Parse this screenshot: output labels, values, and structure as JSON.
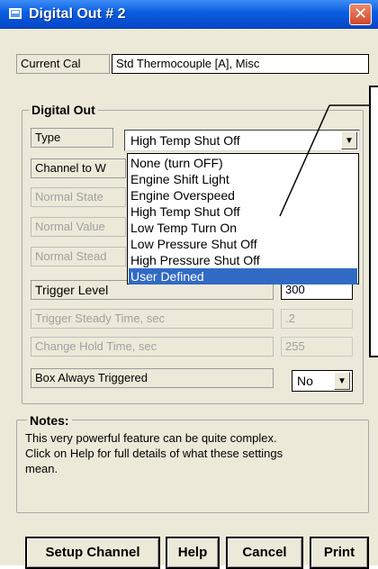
{
  "window": {
    "title": "Digital Out # 2",
    "close_glyph": "✕"
  },
  "current_cal": {
    "label": "Current Cal",
    "value": "Std Thermocouple [A], Misc"
  },
  "digital_out": {
    "legend": "Digital Out",
    "type_label": "Type",
    "type_value": "High Temp Shut Off",
    "channel_label_partial": "Channel to W",
    "normal_state_label_partial": "Normal State",
    "normal_value_label_partial": "Normal Value",
    "normal_steady_label_partial": "Normal Stead",
    "trigger_level_label": "Trigger Level",
    "trigger_level_value": "300",
    "trigger_steady_label": "Trigger Steady Time, sec",
    "trigger_steady_value": ".2",
    "change_hold_label": "Change Hold Time, sec",
    "change_hold_value": "255",
    "box_always_label": "Box Always Triggered",
    "box_always_value": "No"
  },
  "dropdown": {
    "options": [
      "None (turn OFF)",
      "Engine Shift Light",
      "Engine Overspeed",
      "High Temp Shut Off",
      "Low Temp Turn On",
      "Low Pressure Shut Off",
      "High Pressure Shut Off",
      "User Defined"
    ],
    "highlighted": "User Defined"
  },
  "notes": {
    "legend": "Notes:",
    "line1": "This very powerful feature can be quite complex.",
    "line2": "Click on Help for full details of what these settings",
    "line3": "mean."
  },
  "buttons": {
    "setup_channel": "Setup Channel",
    "help": "Help",
    "cancel": "Cancel",
    "print": "Print"
  },
  "icons": {
    "arrow": "▼"
  },
  "colors": {
    "titlebar": "#0a5de0",
    "selection": "#316ac5",
    "window_bg": "#ece9d8"
  }
}
